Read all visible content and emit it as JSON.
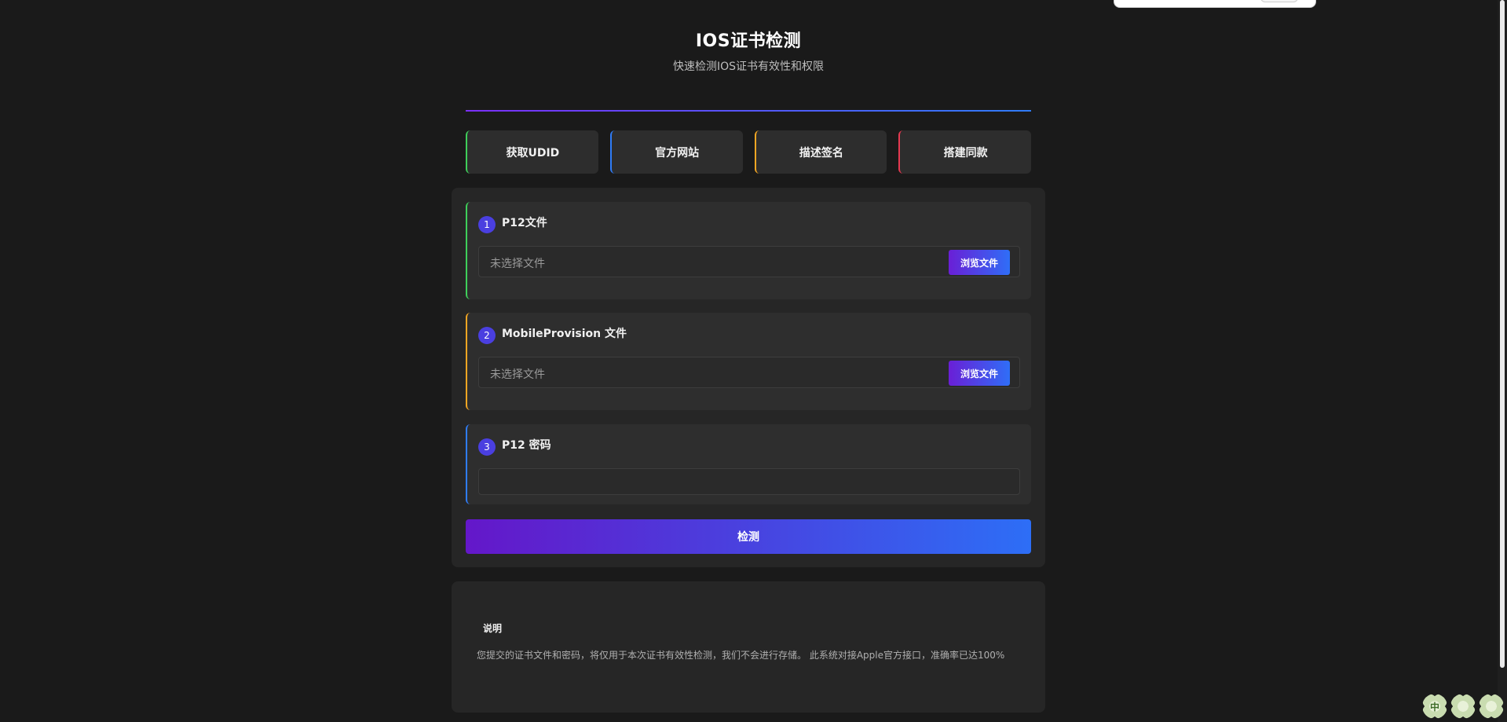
{
  "header": {
    "title": "IOS证书检测",
    "subtitle": "快速检测IOS证书有效性和权限"
  },
  "tabs": [
    {
      "label": "获取UDID",
      "color": "#3ecf5a"
    },
    {
      "label": "官方网站",
      "color": "#2f7cf7"
    },
    {
      "label": "描述签名",
      "color": "#f5a623"
    },
    {
      "label": "搭建同款",
      "color": "#e53950"
    }
  ],
  "form": {
    "steps": [
      {
        "number": "1",
        "title": "P12文件",
        "file_text": "未选择文件",
        "browse_label": "浏览文件",
        "accent": "#3ecf5a"
      },
      {
        "number": "2",
        "title": "MobileProvision 文件",
        "file_text": "未选择文件",
        "browse_label": "浏览文件",
        "accent": "#f5a623"
      },
      {
        "number": "3",
        "title": "P12 密码",
        "password_value": "",
        "accent": "#2f7cf7"
      }
    ],
    "submit_label": "检测"
  },
  "info": {
    "title": "说明",
    "text": "您提交的证书文件和密码，将仅用于本次证书有效性检测，我们不会进行存储。 此系统对接Apple官方接口，准确率已达100%"
  },
  "widget": {
    "clover_label": "中",
    "clover_icon": "clover-icon"
  }
}
